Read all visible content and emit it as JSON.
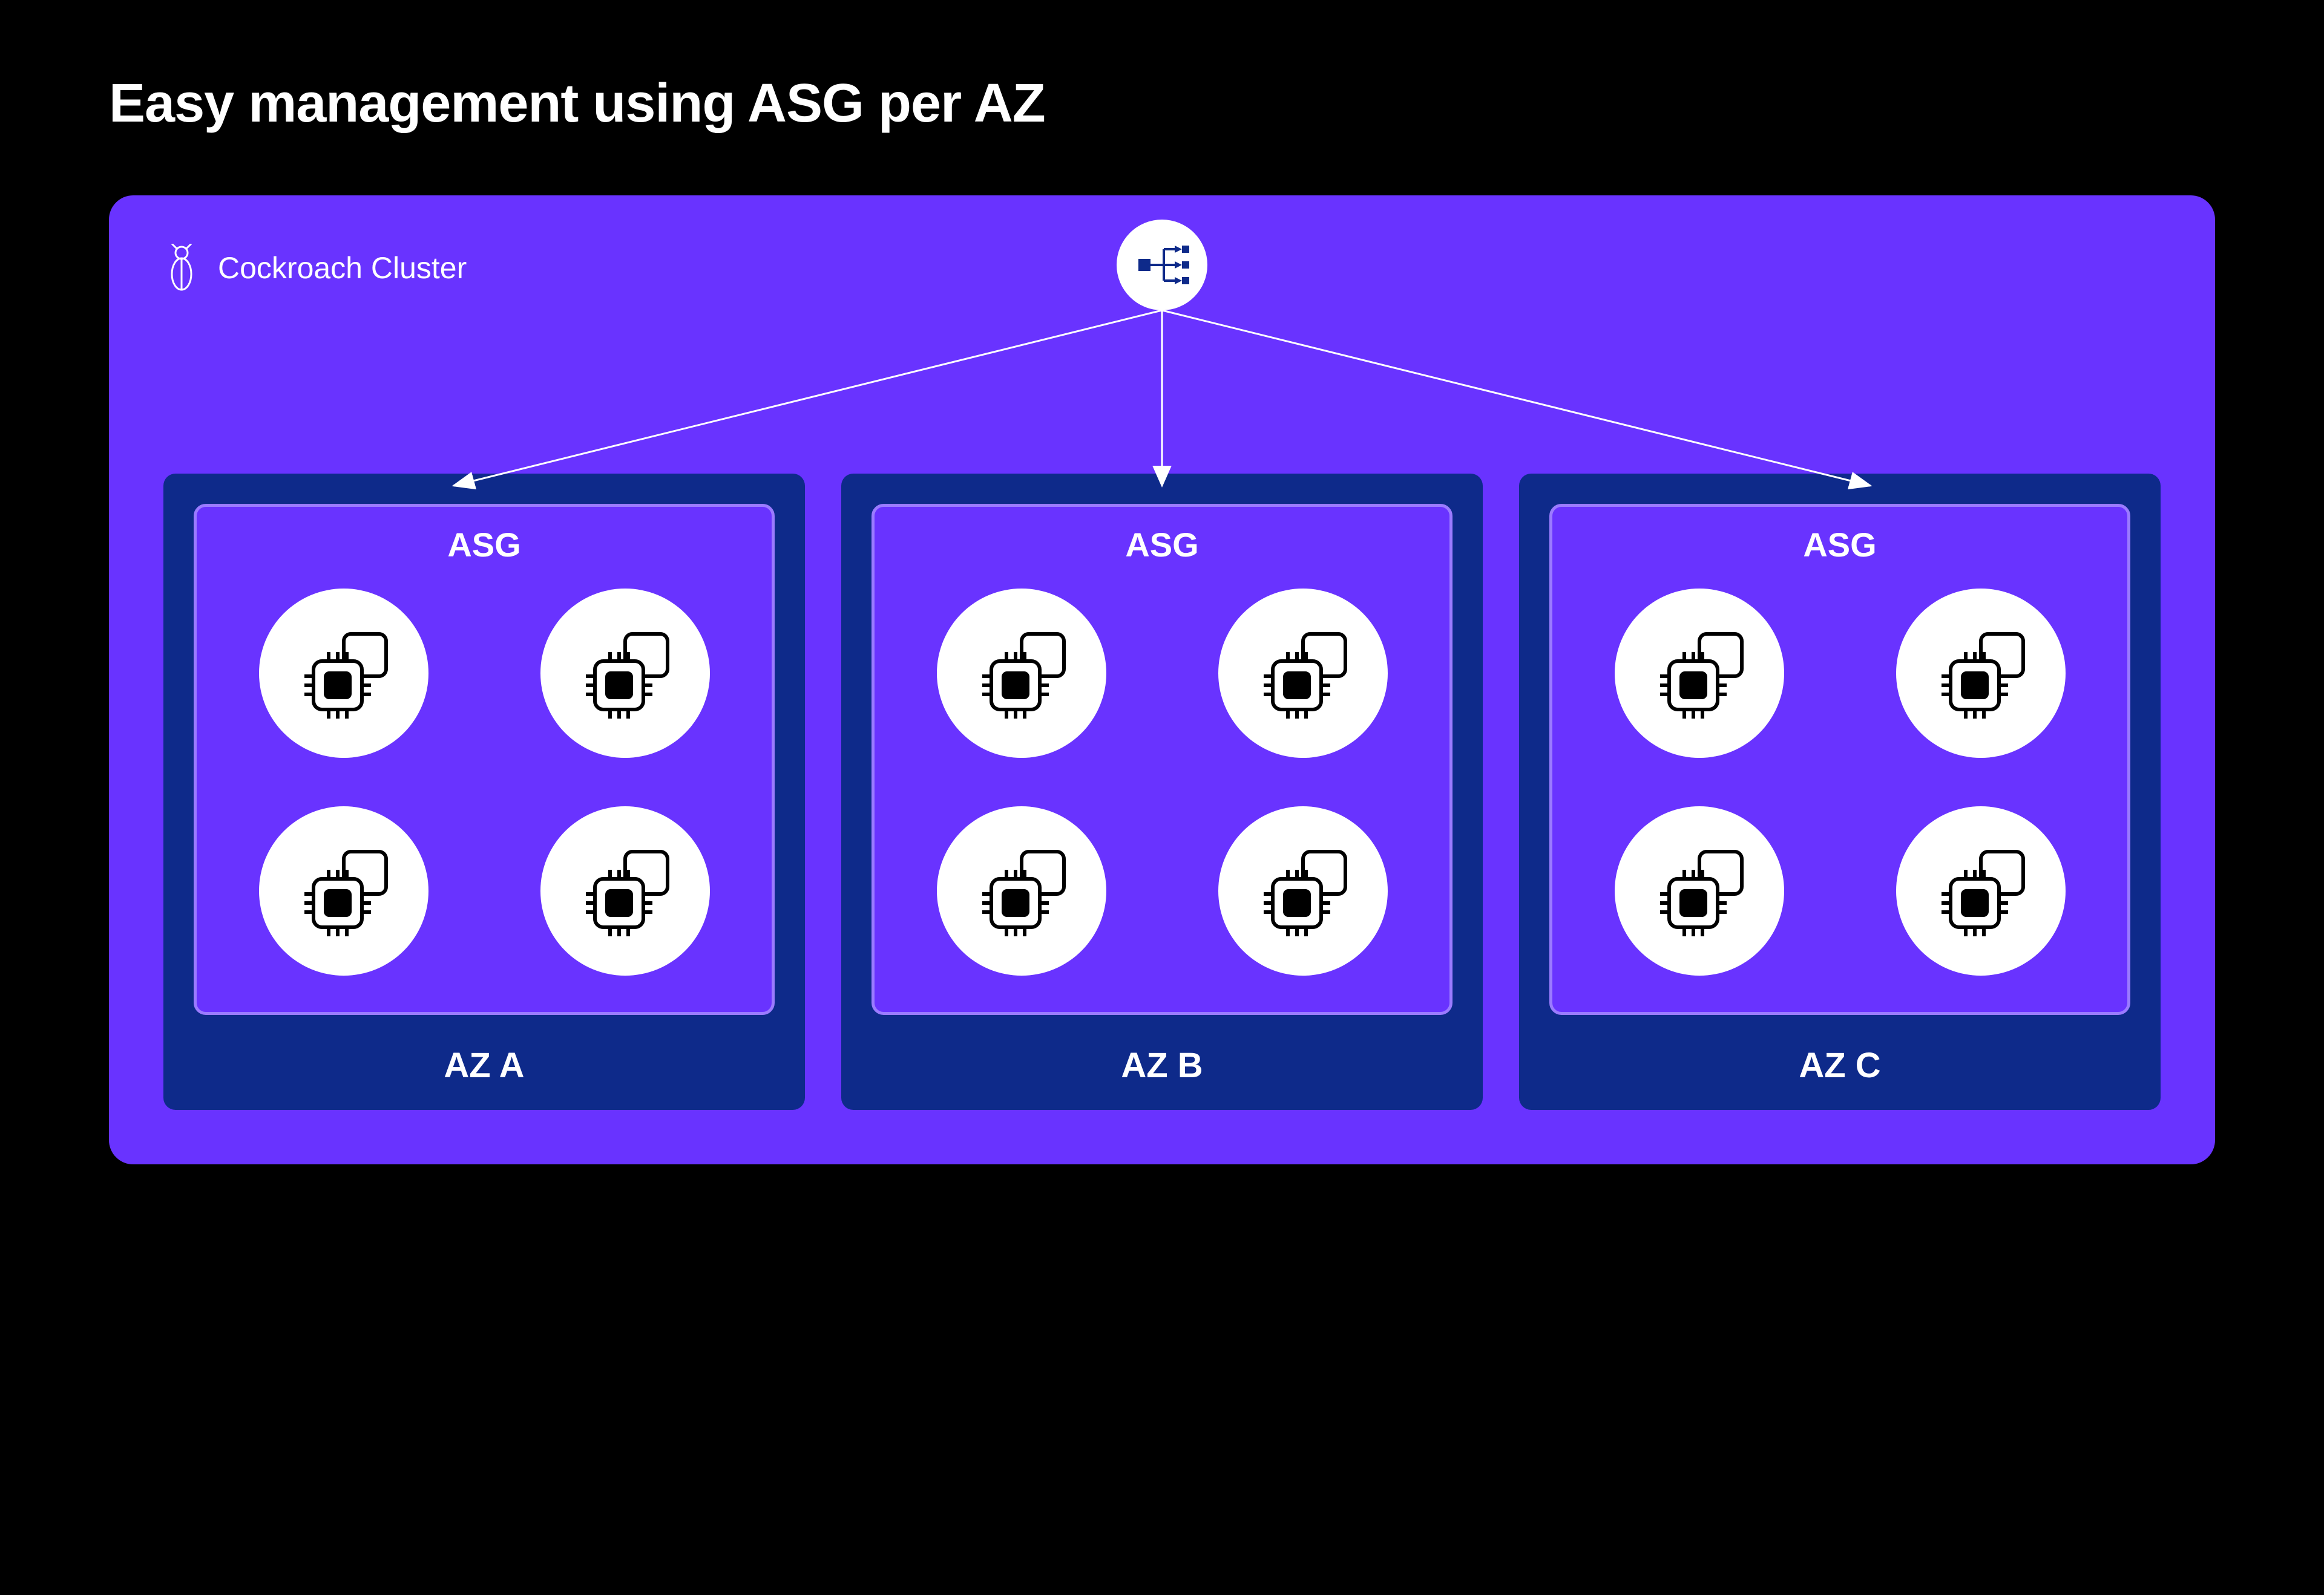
{
  "title": "Easy management using ASG per AZ",
  "cluster": {
    "label": "Cockroach Cluster"
  },
  "zones": [
    {
      "asg_label": "ASG",
      "az_label": "AZ A",
      "node_count": 4
    },
    {
      "asg_label": "ASG",
      "az_label": "AZ B",
      "node_count": 4
    },
    {
      "asg_label": "ASG",
      "az_label": "AZ C",
      "node_count": 4
    }
  ],
  "colors": {
    "background": "#000000",
    "panel": "#6933FF",
    "az_box": "#0E2A8A",
    "asg_border": "#9B7BFF",
    "node_circle": "#FFFFFF"
  }
}
